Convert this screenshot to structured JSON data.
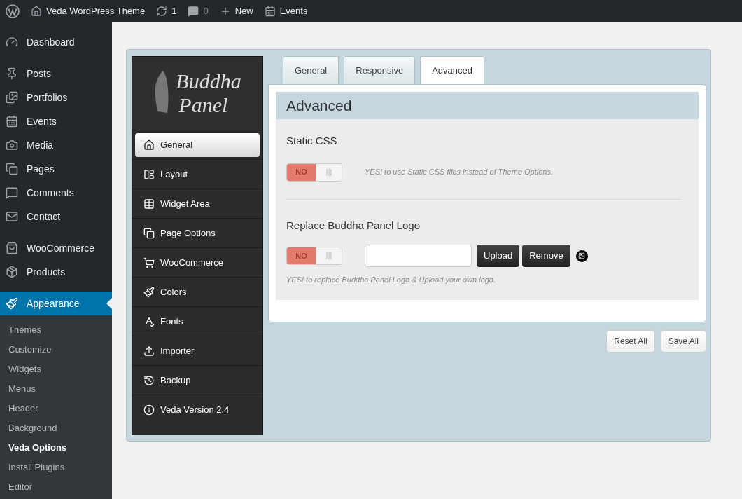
{
  "admin_bar": {
    "site_name": "Veda WordPress Theme",
    "updates": "1",
    "comments": "0",
    "new": "New",
    "events": "Events"
  },
  "sidebar": {
    "groups": [
      [
        {
          "label": "Dashboard",
          "selected": false
        }
      ],
      [
        {
          "label": "Posts",
          "selected": false
        },
        {
          "label": "Portfolios",
          "selected": false
        },
        {
          "label": "Events",
          "selected": false
        },
        {
          "label": "Media",
          "selected": false
        },
        {
          "label": "Pages",
          "selected": false
        },
        {
          "label": "Comments",
          "selected": false
        },
        {
          "label": "Contact",
          "selected": false
        }
      ],
      [
        {
          "label": "WooCommerce",
          "selected": false
        },
        {
          "label": "Products",
          "selected": false
        }
      ],
      [
        {
          "label": "Appearance",
          "selected": true
        }
      ]
    ],
    "submenu": [
      {
        "label": "Themes",
        "selected": false
      },
      {
        "label": "Customize",
        "selected": false
      },
      {
        "label": "Widgets",
        "selected": false
      },
      {
        "label": "Menus",
        "selected": false
      },
      {
        "label": "Header",
        "selected": false
      },
      {
        "label": "Background",
        "selected": false
      },
      {
        "label": "Veda Options",
        "selected": true
      },
      {
        "label": "Install Plugins",
        "selected": false
      },
      {
        "label": "Editor",
        "selected": false
      }
    ]
  },
  "panel": {
    "logo_line1": "Buddha",
    "logo_line2": "Panel",
    "nav": [
      {
        "label": "General",
        "selected": true
      },
      {
        "label": "Layout",
        "selected": false
      },
      {
        "label": "Widget Area",
        "selected": false
      },
      {
        "label": "Page Options",
        "selected": false
      },
      {
        "label": "WooCommerce",
        "selected": false
      },
      {
        "label": "Colors",
        "selected": false
      },
      {
        "label": "Fonts",
        "selected": false
      },
      {
        "label": "Importer",
        "selected": false
      },
      {
        "label": "Backup",
        "selected": false
      },
      {
        "label": "Veda Version 2.4",
        "selected": false
      }
    ],
    "tabs": [
      {
        "label": "General",
        "selected": false
      },
      {
        "label": "Responsive",
        "selected": false
      },
      {
        "label": "Advanced",
        "selected": true
      }
    ],
    "section_title": "Advanced",
    "options": [
      {
        "kind": "toggle",
        "title": "Static CSS",
        "toggle_label": "NO",
        "on": false,
        "description": "YES! to use Static CSS files instead of Theme Options."
      },
      {
        "kind": "upload",
        "title": "Replace Buddha Panel Logo",
        "toggle_label": "NO",
        "on": false,
        "upload": "Upload",
        "remove": "Remove",
        "description": "YES! to replace Buddha Panel Logo & Upload your own logo."
      }
    ],
    "buttons": [
      "Reset All",
      "Save All"
    ]
  }
}
